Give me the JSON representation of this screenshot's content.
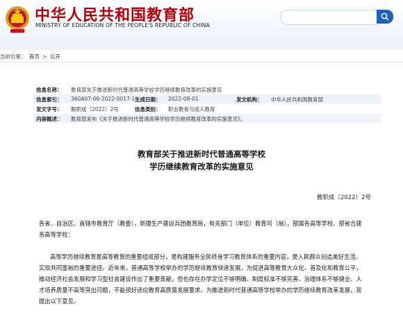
{
  "header": {
    "site_name_cn": "中华人民共和国教育部",
    "site_name_en": "MINISTRY OF EDUCATION OF THE PEOPLE'S REPUBLIC OF CHINA",
    "brand_color": "#b4000b",
    "search_button_color": "#1e64b4",
    "search_placeholder": ""
  },
  "breadcrumb": {
    "prefix": "当前位置：",
    "items": [
      "首页",
      "公开"
    ],
    "separator": ">"
  },
  "info": {
    "row1": {
      "label": "信息名称：",
      "value": "教育部关于推进新时代普通高等学校学历继续教育改革的实施意见"
    },
    "row2": {
      "label1": "信息索引：",
      "value1": "360A07-06-2022-0017-1",
      "label2": "生成日期：",
      "value2": "2022-08-01",
      "label3": "发文机构：",
      "value3": "中华人民共和国教育部"
    },
    "row3": {
      "label1": "发文字号：",
      "value1": "教职成〔2022〕2号",
      "label2": "信息类别：",
      "value2": "职业教育与成人教育"
    },
    "row4": {
      "label": "内容概述：",
      "value": "教育部发布《关于推进新时代普通高等学校学历继续教育改革的实施意见》。"
    }
  },
  "document": {
    "title_line1": "教育部关于推进新时代普通高等学校",
    "title_line2": "学历继续教育改革的实施意见",
    "doc_number": "教职成〔2022〕2号",
    "addressee": "各省、自治区、直辖市教育厅（教委），新疆生产建设兵团教育局，有关部门（单位）教育司（局），部属各高等学校、部省合建各高等学校：",
    "body": "高等学历继续教育是高等教育的重要组成部分，是构建服务全民终身学习教育体系的重要内容，是人民群众创造美好生活、实现共同富裕的重要途径。近年来，普通高等学校举办的学历继续教育快速发展，为促进高等教育大众化、普及化和教育公平，推动经济社会发展和学习型社会建设作出了重要贡献，但也存在办学定位不够明确、制度标准不够完善、治理体系不够健全、人才培养质量不高等突出问题，不能很好适应教育高质量发展要求。为推进新时代普通高等学校举办的学历继续教育改革发展，现提出以下意见。"
  }
}
